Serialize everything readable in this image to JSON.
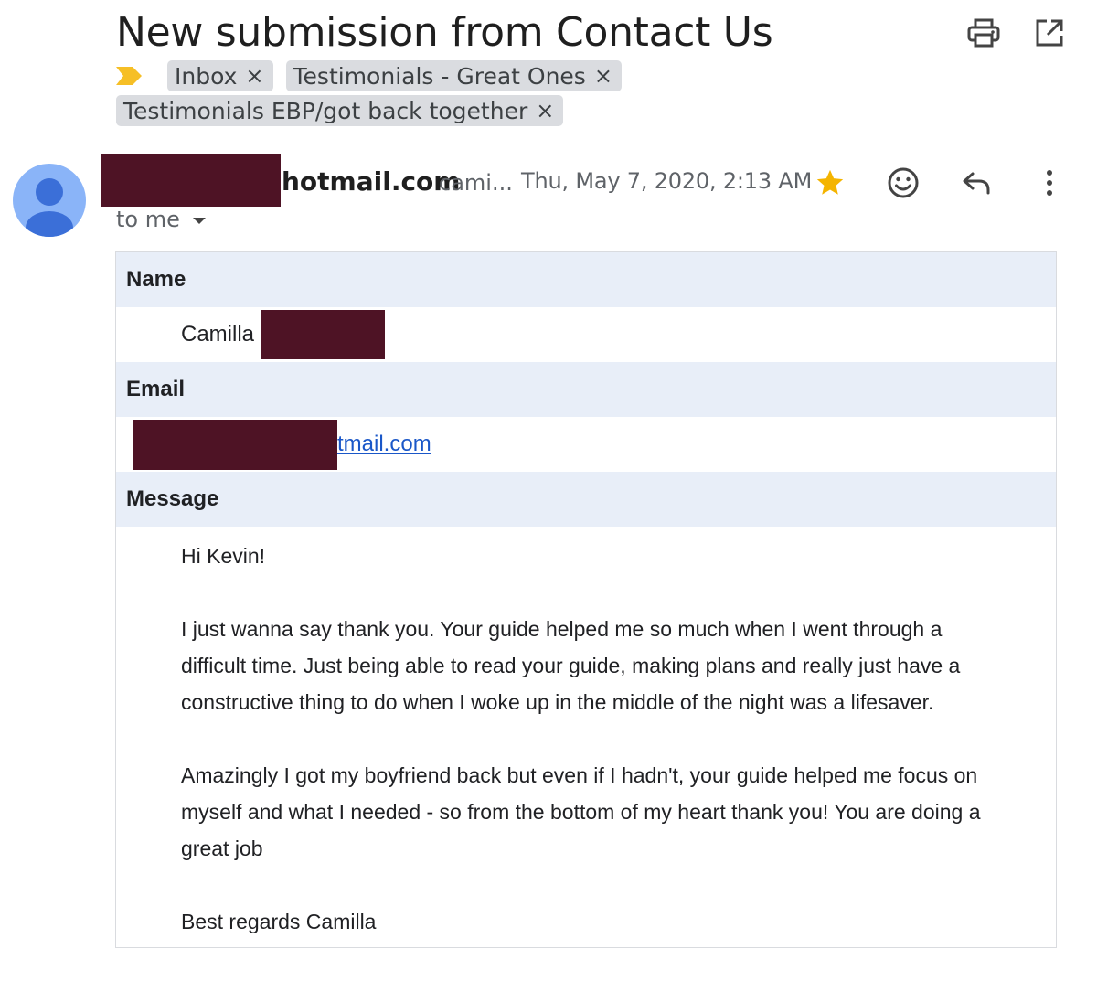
{
  "email": {
    "subject": "New submission from Contact Us",
    "labels": [
      {
        "name": "Inbox"
      },
      {
        "name": "Testimonials - Great Ones"
      },
      {
        "name": "Testimonials EBP/got back together"
      }
    ],
    "sender_domain": "hotmail.com",
    "sender_extra": "cami...",
    "date": "Thu, May 7, 2020, 2:13 AM",
    "recipient": "to me",
    "starred": true
  },
  "icons": {
    "print": "print-icon",
    "open_new_window": "open-in-new-window-icon",
    "importance": "importance-marker-icon",
    "star": "star-icon",
    "emoji": "emoji-reaction-icon",
    "reply": "reply-icon",
    "more": "more-vert-icon"
  },
  "form": {
    "name_label": "Name",
    "name_value": "Camilla",
    "email_label": "Email",
    "email_value": "tmail.com",
    "message_label": "Message",
    "message_lines": [
      "Hi Kevin!",
      "I just wanna say thank you. Your guide helped me so much when I went through a",
      "difficult time. Just being able to read your guide, making plans and really just have a",
      "constructive thing to do when I woke up in the middle of the night was a lifesaver.",
      "Amazingly I got my boyfriend back but even if I hadn't, your guide helped me focus on",
      "myself and what I needed - so from the bottom of my heart thank you! You are doing a",
      "great job",
      "Best regards Camilla"
    ]
  },
  "colors": {
    "star": "#f4b400",
    "importance": "#f6bf26",
    "avatar_bg": "#8ab4f8",
    "avatar_fg": "#3b6fd8",
    "redaction": "#4e1325",
    "header_row_bg": "#e8eef8",
    "link": "#1a57c8"
  }
}
